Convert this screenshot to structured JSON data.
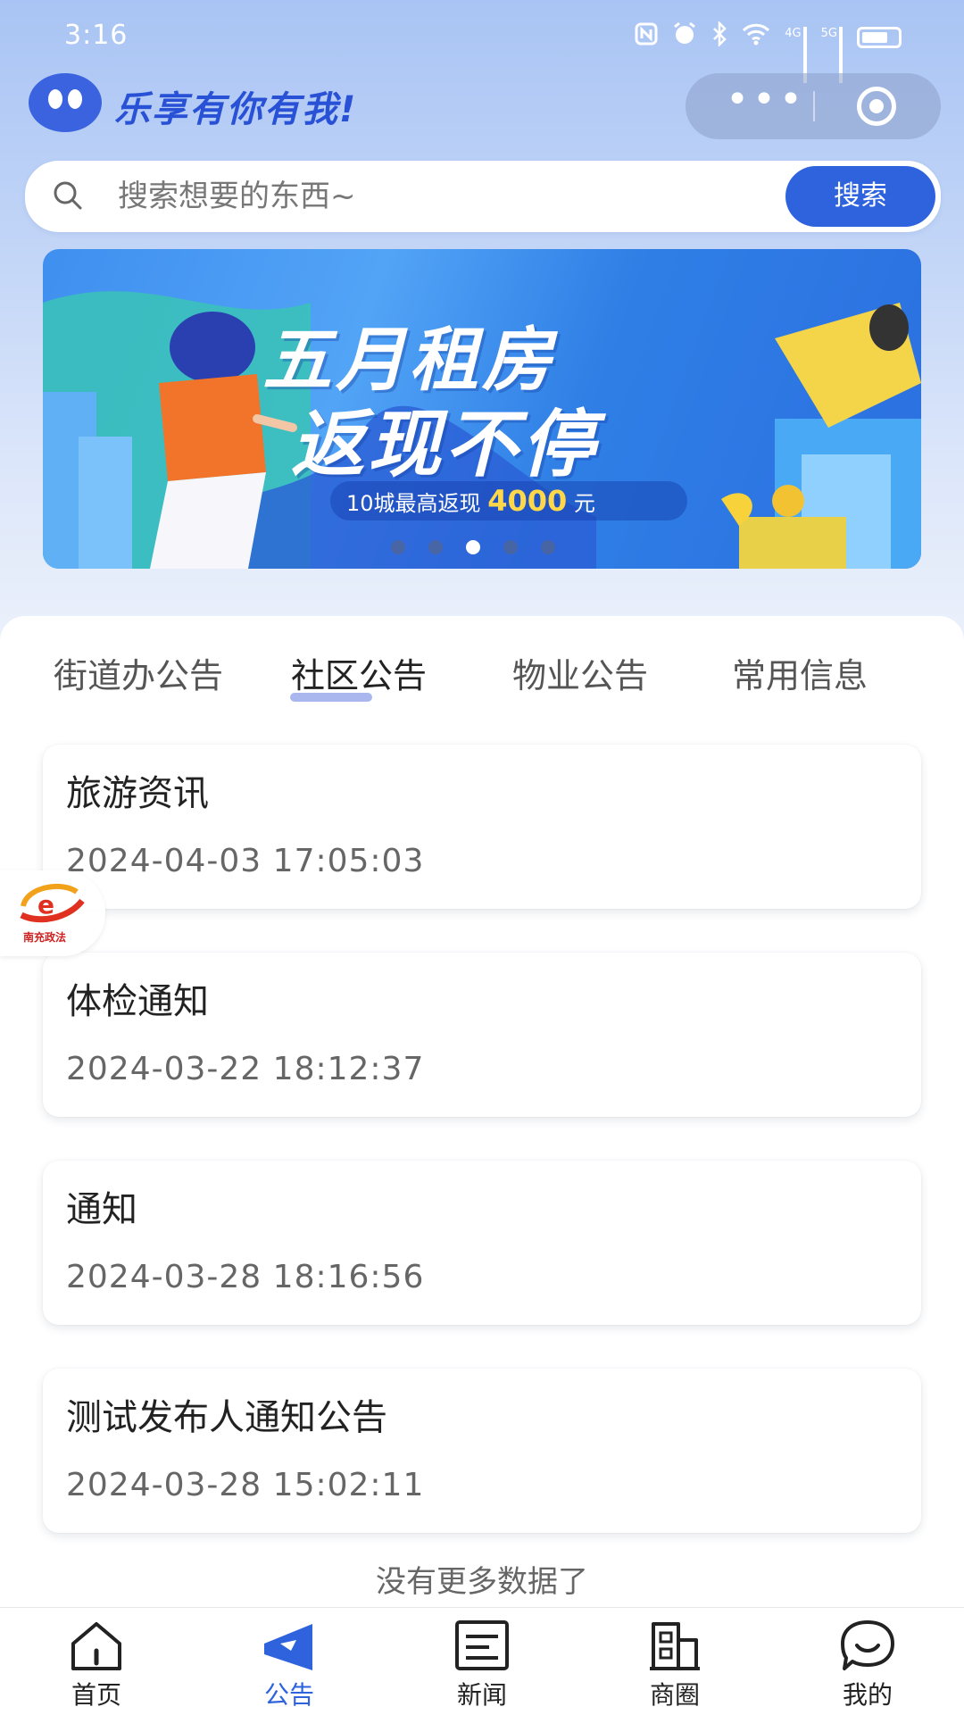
{
  "status_bar": {
    "time": "3:16",
    "network_4g": "4G",
    "network_5g": "5G"
  },
  "header": {
    "app_title": "乐享有你有我!"
  },
  "search": {
    "placeholder": "搜索想要的东西~",
    "button_label": "搜索"
  },
  "banner": {
    "title_line1": "五月租房",
    "title_line2": "返现不停",
    "subtitle_prefix": "10城最高返现",
    "subtitle_amount": "4000",
    "subtitle_suffix": "元",
    "slide_count": 5,
    "active_slide": 2
  },
  "tabs": [
    {
      "label": "街道办公告",
      "active": false
    },
    {
      "label": "社区公告",
      "active": true
    },
    {
      "label": "物业公告",
      "active": false
    },
    {
      "label": "常用信息",
      "active": false
    }
  ],
  "notices": [
    {
      "title": "旅游资讯",
      "time": "2024-04-03 17:05:03"
    },
    {
      "title": "体检通知",
      "time": "2024-03-22 18:12:37"
    },
    {
      "title": "通知",
      "time": "2024-03-28 18:16:56"
    },
    {
      "title": "测试发布人通知公告",
      "time": "2024-03-28 15:02:11"
    }
  ],
  "no_more_text": "没有更多数据了",
  "float_badge": {
    "text": "南充政法"
  },
  "tabbar": [
    {
      "label": "首页",
      "icon": "home-icon",
      "active": false
    },
    {
      "label": "公告",
      "icon": "megaphone-icon",
      "active": true
    },
    {
      "label": "新闻",
      "icon": "newspaper-icon",
      "active": false
    },
    {
      "label": "商圈",
      "icon": "building-icon",
      "active": false
    },
    {
      "label": "我的",
      "icon": "smile-icon",
      "active": false
    }
  ],
  "colors": {
    "accent": "#2f63de",
    "title": "#2851d6",
    "text": "#222222",
    "muted": "#666666"
  }
}
